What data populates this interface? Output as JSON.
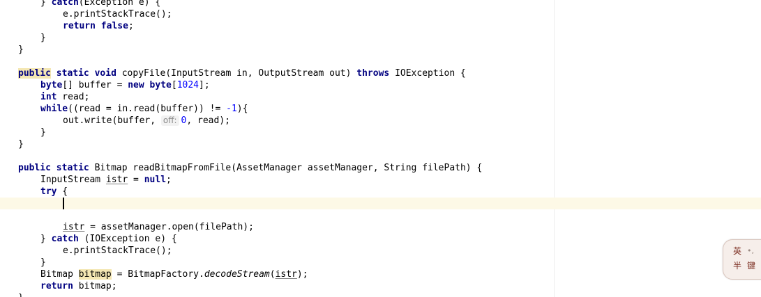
{
  "editor": {
    "lines": {
      "l1_close": "} ",
      "l1_catch": "catch",
      "l1_rest": "(Exception e) {",
      "l2": "e.printStackTrace();",
      "l3_return": "return",
      "l3_false": "false",
      "l3_semi": ";",
      "l4": "}",
      "l5": "}",
      "m1_public": "public",
      "m1_static": "static",
      "m1_void": "void",
      "m1_sig": " copyFile(InputStream in, OutputStream out) ",
      "m1_throws": "throws",
      "m1_tail": " IOException {",
      "m2_byte1": "byte",
      "m2_mid": "[] buffer = ",
      "m2_new": "new",
      "m2_byte2": "byte",
      "m2_open": "[",
      "m2_num": "1024",
      "m2_close": "];",
      "m3_int": "int",
      "m3_rest": " read;",
      "m4_while": "while",
      "m4_mid": "((read = in.read(buffer)) != ",
      "m4_num": "-1",
      "m4_tail": "){",
      "m5_pre": "out.write(buffer, ",
      "m5_hint": "off:",
      "m5_num": "0",
      "m5_tail": ", read);",
      "m6": "}",
      "m7": "}",
      "b1_public": "public",
      "b1_static": "static",
      "b1_sig": " Bitmap readBitmapFromFile(AssetManager assetManager, String filePath) {",
      "b2_pre": "InputStream ",
      "b2_var": "istr",
      "b2_mid": " = ",
      "b2_null": "null",
      "b2_semi": ";",
      "b3_try": "try",
      "b3_brace": " {",
      "b6_var": "istr",
      "b6_rest": " = assetManager.open(filePath);",
      "b7_close": "} ",
      "b7_catch": "catch",
      "b7_rest": " (IOException e) {",
      "b8": "e.printStackTrace();",
      "b9": "}",
      "b10_pre": "Bitmap ",
      "b10_var": "bitmap",
      "b10_mid": " = BitmapFactory.",
      "b10_method": "decodeStream",
      "b10_open": "(",
      "b10_arg": "istr",
      "b10_tail": ");",
      "b11_return": "return",
      "b11_rest": " bitmap;",
      "b12": "}"
    }
  },
  "ime": {
    "char1": "英",
    "dots": "•,",
    "char2": "半",
    "char3": "键"
  },
  "colors": {
    "keyword": "#000080",
    "number": "#0000ff",
    "caret_row": "#fdf9e6",
    "usage_highlight": "#f4e7b3"
  }
}
